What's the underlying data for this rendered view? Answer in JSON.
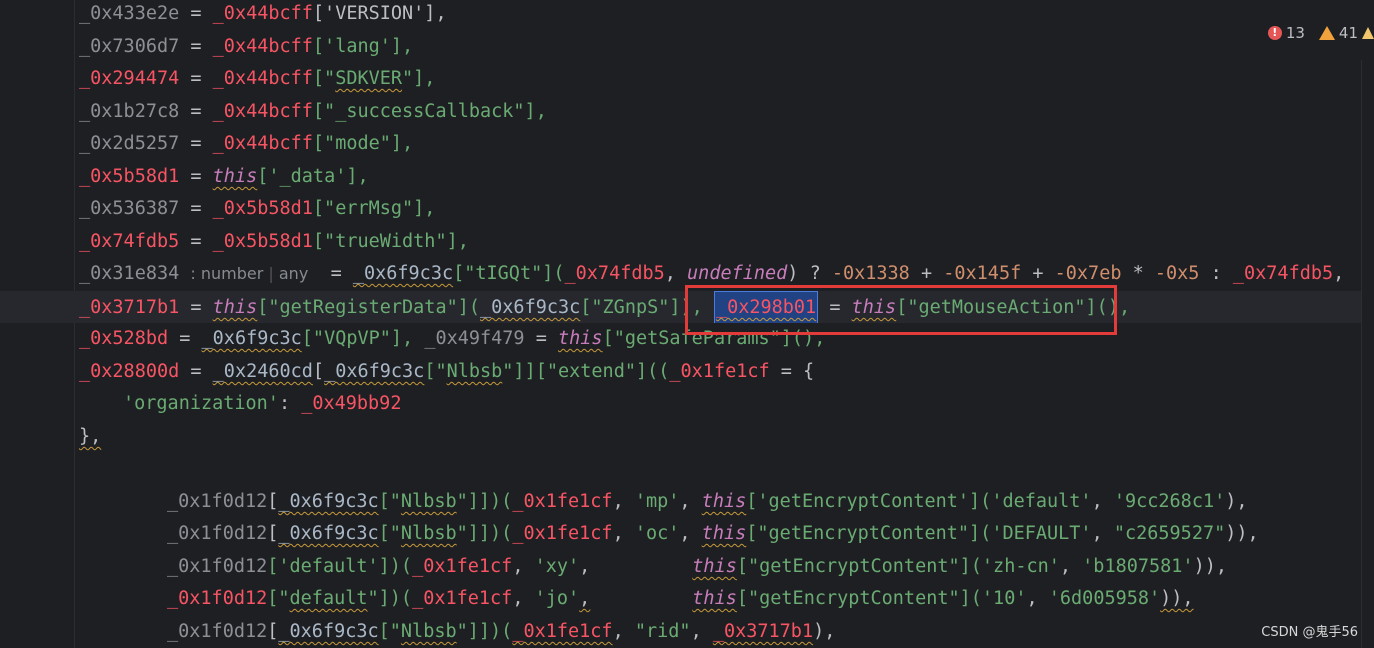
{
  "status": {
    "errors": "13",
    "warnings": "41"
  },
  "code": {
    "l0": {
      "a": "_0x433e2e",
      "b": " = ",
      "c": "_0x44bcff",
      "d": "['VERSION'],"
    },
    "l1": {
      "a": "_0x7306d7",
      "b": " = ",
      "c": "_0x44bcff",
      "d": "['",
      "e": "lang",
      "f": "'],"
    },
    "l2": {
      "a": "_0x294474",
      "b": " = ",
      "c": "_0x44bcff",
      "d": "[\"",
      "e": "SDKVER",
      "f": "\"],"
    },
    "l3": {
      "a": "_0x1b27c8",
      "b": " = ",
      "c": "_0x44bcff",
      "d": "[\"",
      "e": "_successCallback",
      "f": "\"],"
    },
    "l4": {
      "a": "_0x2d5257",
      "b": " = ",
      "c": "_0x44bcff",
      "d": "[\"",
      "e": "mode",
      "f": "\"],"
    },
    "l5": {
      "a": "_0x5b58d1",
      "b": " = ",
      "c": "this",
      "d": "['",
      "e": "_data",
      "f": "'],"
    },
    "l6": {
      "a": "_0x536387",
      "b": " = ",
      "c": "_0x5b58d1",
      "d": "[\"",
      "e": "errMsg",
      "f": "\"],"
    },
    "l7": {
      "a": "_0x74fdb5",
      "b": " = ",
      "c": "_0x5b58d1",
      "d": "[\"",
      "e": "trueWidth",
      "f": "\"],"
    },
    "l8": {
      "a": "_0x31e834",
      "hint1": ": number",
      "hint2": "any",
      "b": " = ",
      "c": "_0x6f9c3c",
      "d": "[\"",
      "e": "tIGQt",
      "f": "\"](",
      "g": "_0x74fdb5",
      "h": ", ",
      "i": "undefined",
      "j": ") ? ",
      "k": "-0x1338",
      "l": " + ",
      "m": "-0x145f",
      "n": " + ",
      "o": "-0x7eb",
      "p": " * ",
      "q": "-0x5",
      "r": " : ",
      "s": "_0x74fdb5",
      "t": ","
    },
    "l9": {
      "a": "_0x3717b1",
      "b": " = ",
      "c": "this",
      "d": "[\"",
      "e": "getRegisterData",
      "f": "\"](",
      "g": "_0x6f9c3c",
      "h": "[\"",
      "i": "ZGnpS",
      "j": "\"]), ",
      "k": "_0x298b01",
      "l": " = ",
      "m": "this",
      "n": "[\"",
      "o": "getMouseAction",
      "p": "\"](),"
    },
    "l10": {
      "a": "_0x528bd",
      "b": " = ",
      "c": "_0x6f9c3c",
      "d": "[\"",
      "e": "VQpVP",
      "f": "\"], ",
      "g": "_0x49f479",
      "h": " = ",
      "i": "this",
      "j": "[\"",
      "k": "getSafeParams",
      "l": "\"](),"
    },
    "l11": {
      "a": "_0x28800d",
      "b": " = ",
      "c": "_0x2460cd",
      "d": "[",
      "e": "_0x6f9c3c",
      "f": "[\"",
      "g": "Nlbsb",
      "h": "\"]][\"",
      "i": "extend",
      "j": "\"]((",
      "k": "_0x1fe1cf",
      "l": " = {"
    },
    "l12": {
      "a": "'organization'",
      "b": ": ",
      "c": "_0x49bb92"
    },
    "l13": {
      "a": "},"
    },
    "l15": {
      "a": "_0x1f0d12",
      "b": "[",
      "c": "_0x6f9c3c",
      "d": "[\"",
      "e": "Nlbsb",
      "f": "\"]])(",
      "g": "_0x1fe1cf",
      "h": ", ",
      "i": "'mp'",
      "j": ", ",
      "k": "this",
      "l": "['",
      "m": "getEncryptContent",
      "n": "'](",
      "o": "'default'",
      "p": ", ",
      "q": "'9cc268c1'",
      "r": "),"
    },
    "l16": {
      "a": "_0x1f0d12",
      "b": "[",
      "c": "_0x6f9c3c",
      "d": "[\"",
      "e": "Nlbsb",
      "f": "\"]])(",
      "g": "_0x1fe1cf",
      "h": ", ",
      "i": "'oc'",
      "j": ", ",
      "k": "this",
      "l": "[\"",
      "m": "getEncryptContent",
      "n": "\"](",
      "o": "'DEFAULT'",
      "p": ", ",
      "q": "\"c2659527\"",
      "r": ")),"
    },
    "l17": {
      "a": "_0x1f0d12",
      "b": "['",
      "c": "default",
      "d": "'])(",
      "e": "_0x1fe1cf",
      "f": ", ",
      "g": "'xy'",
      "h": ",",
      "k": "this",
      "l": "[\"",
      "m": "getEncryptContent",
      "n": "\"](",
      "o": "'zh-cn'",
      "p": ", ",
      "q": "'b1807581'",
      "r": ")),"
    },
    "l18": {
      "a": "_0x1f0d12",
      "b": "[\"",
      "c": "default",
      "d": "\"])(",
      "e": "_0x1fe1cf",
      "f": ", ",
      "g": "'jo'",
      "h": ",",
      "k": "this",
      "l": "[\"",
      "m": "getEncryptContent",
      "n": "\"](",
      "o": "'10'",
      "p": ", ",
      "q": "'6d005958'",
      "r": ")),"
    },
    "l19": {
      "a": "_0x1f0d12",
      "b": "[",
      "c": "_0x6f9c3c",
      "d": "[\"",
      "e": "Nlbsb",
      "f": "\"]])(",
      "g": "_0x1fe1cf",
      "h": ", ",
      "i": "\"rid\"",
      "j": ", ",
      "k": "_0x3717b1",
      "l": "),"
    }
  },
  "watermark": "CSDN @鬼手56"
}
